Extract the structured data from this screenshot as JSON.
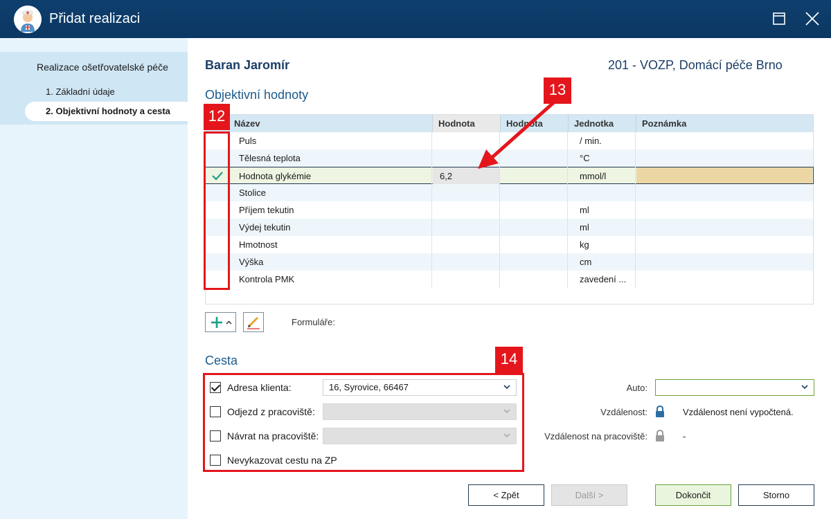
{
  "window": {
    "title": "Přidat realizaci",
    "icons": [
      "nurse-avatar-icon",
      "maximize-icon",
      "close-icon"
    ]
  },
  "sidebar": {
    "group": "Realizace ošetřovatelské péče",
    "steps": [
      {
        "label": "1. Základní údaje",
        "active": false
      },
      {
        "label": "2. Objektivní hodnoty a cesta",
        "active": true
      }
    ]
  },
  "header": {
    "patient": "Baran Jaromír",
    "insurer": "201 - VOZP, Domácí péče Brno"
  },
  "objective": {
    "title": "Objektivní hodnoty",
    "columns": [
      "Název",
      "Hodnota",
      "Hodnota",
      "Jednotka",
      "Poznámka"
    ],
    "rows": [
      {
        "name": "Puls",
        "value": "",
        "value2": "",
        "unit": "/ min.",
        "note": "",
        "checked": false
      },
      {
        "name": "Tělesná teplota",
        "value": "",
        "value2": "",
        "unit": "°C",
        "note": "",
        "checked": false
      },
      {
        "name": "Hodnota glykémie",
        "value": "6,2",
        "value2": "",
        "unit": "mmol/l",
        "note": "",
        "checked": true
      },
      {
        "name": "Stolice",
        "value": "",
        "value2": "",
        "unit": "",
        "note": "",
        "checked": false
      },
      {
        "name": "Příjem tekutin",
        "value": "",
        "value2": "",
        "unit": "ml",
        "note": "",
        "checked": false
      },
      {
        "name": "Výdej tekutin",
        "value": "",
        "value2": "",
        "unit": "ml",
        "note": "",
        "checked": false
      },
      {
        "name": "Hmotnost",
        "value": "",
        "value2": "",
        "unit": "kg",
        "note": "",
        "checked": false
      },
      {
        "name": "Výška",
        "value": "",
        "value2": "",
        "unit": "cm",
        "note": "",
        "checked": false
      },
      {
        "name": "Kontrola PMK",
        "value": "",
        "value2": "",
        "unit": "zavedení ...",
        "note": "",
        "checked": false
      }
    ],
    "toolbar": {
      "add_icon": "plus-icon",
      "edit_icon": "pencil-icon",
      "forms_label": "Formuláře:"
    }
  },
  "route": {
    "title": "Cesta",
    "client_address": {
      "label": "Adresa klienta:",
      "checked": true,
      "value": "16, Syrovice, 66467"
    },
    "departure": {
      "label": "Odjezd z pracoviště:",
      "checked": false,
      "value": ""
    },
    "return": {
      "label": "Návrat na pracoviště:",
      "checked": false,
      "value": ""
    },
    "no_report": {
      "label": "Nevykazovat cestu na ZP",
      "checked": false
    },
    "car": {
      "label": "Auto:",
      "value": ""
    },
    "distance": {
      "label": "Vzdálenost:",
      "value": "Vzdálenost není vypočtená."
    },
    "distance_workplace": {
      "label": "Vzdálenost na pracoviště:",
      "value": "-"
    }
  },
  "annotations": {
    "badge_12": "12",
    "badge_13": "13",
    "badge_14": "14",
    "color": "#e4161c"
  },
  "footer": {
    "back": "< Zpět",
    "next": "Další >",
    "finish": "Dokončit",
    "cancel": "Storno"
  }
}
